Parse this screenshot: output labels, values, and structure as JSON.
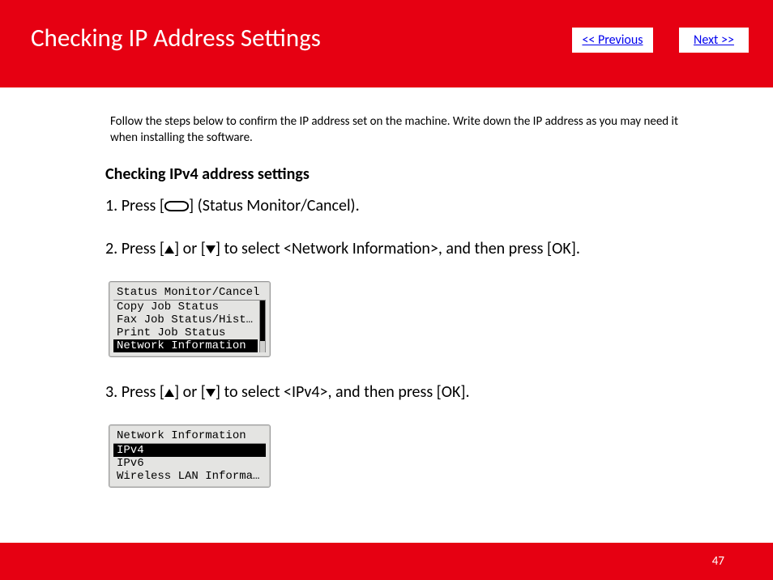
{
  "header": {
    "title": "Checking IP Address Settings",
    "prev_label": "<< Previous",
    "next_label": "Next >>"
  },
  "intro": "Follow the steps below to confirm the IP address set on the machine. Write down the IP address as you may need it when installing the software.",
  "section_heading": "Checking IPv4 address settings",
  "steps": {
    "s1_pre": "1. Press [",
    "s1_post": "] (Status Monitor/Cancel).",
    "s2_pre": "2. Press [",
    "s2_mid1": "] or [",
    "s2_mid2": "] to select <Network Information>, and then press [OK].",
    "s3_pre": "3. Press [",
    "s3_mid1": "] or [",
    "s3_mid2": "] to select <IPv4>, and then press [OK]."
  },
  "lcd1": {
    "title": "Status Monitor/Cancel",
    "items": [
      "Copy Job Status",
      "Fax Job Status/Hist…",
      "Print Job Status",
      "Network Information"
    ],
    "selected_index": 3
  },
  "lcd2": {
    "title": "Network Information",
    "items": [
      "IPv4",
      "IPv6",
      "Wireless LAN Informa…"
    ],
    "selected_index": 0
  },
  "page_number": "47"
}
